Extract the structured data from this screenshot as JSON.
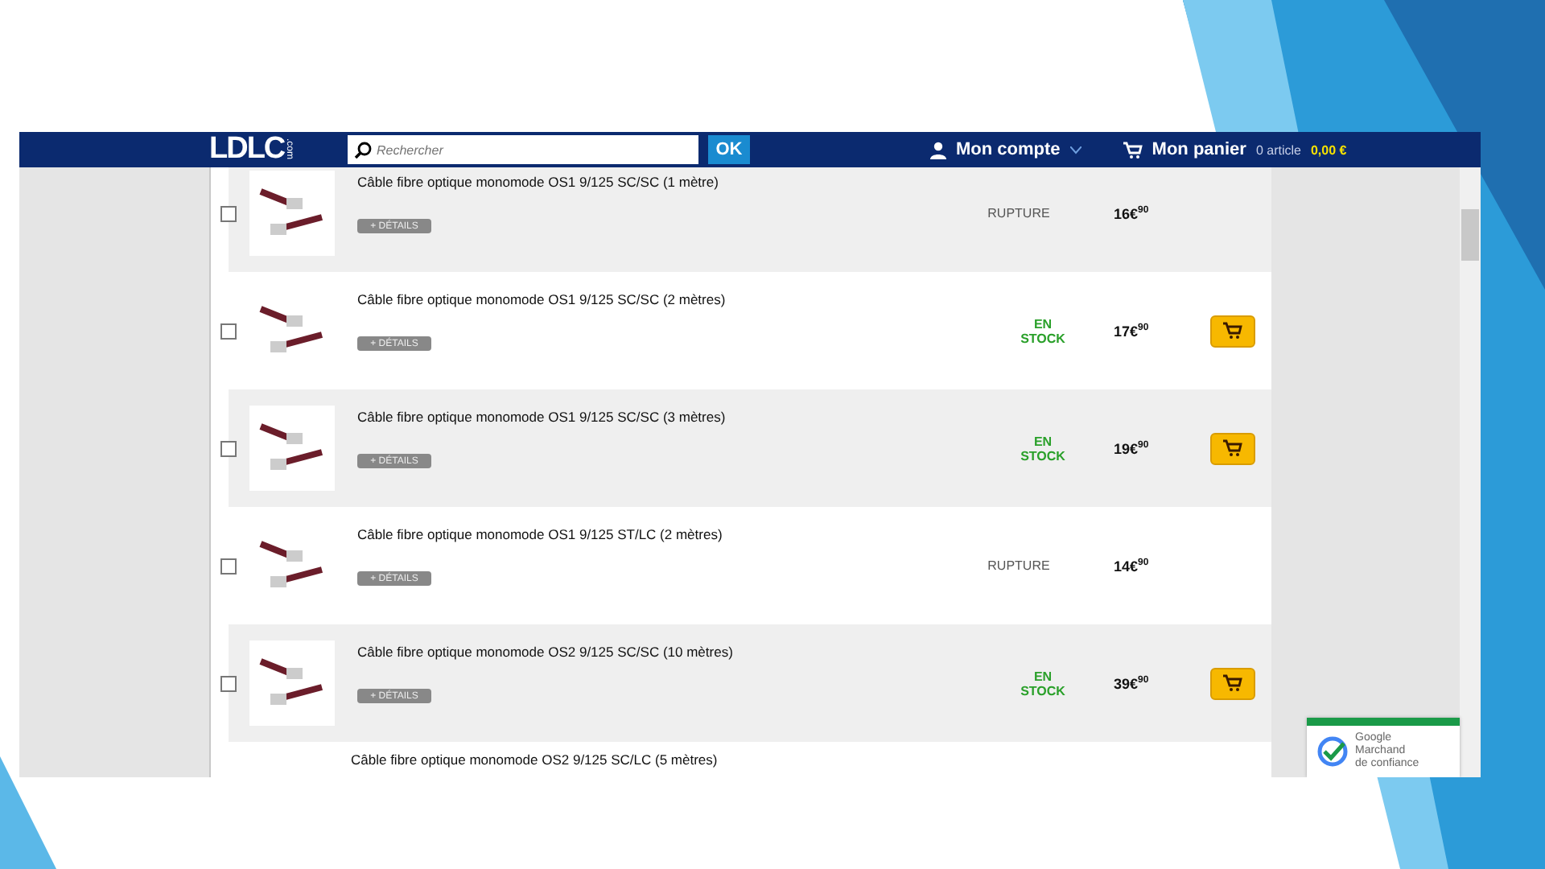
{
  "header": {
    "logo": "LDLC",
    "logo_suffix": ".com",
    "search": {
      "placeholder": "Rechercher",
      "button": "OK"
    },
    "account": "Mon compte",
    "cart": "Mon panier",
    "cart_count": "0 article",
    "cart_total": "0,00 €"
  },
  "products": [
    {
      "title": "Câble fibre optique monomode OS1 9/125 SC/SC (1 mètre)",
      "details": "+ DÉTAILS",
      "checked": false,
      "kind": "rupture",
      "stock": "RUPTURE",
      "price": "16€$^{90}$"
    },
    {
      "title": "Câble fibre optique monomode OS1 9/125 SC/SC (2 mètres)",
      "details": "+ DÉTAILS",
      "checked": false,
      "kind": "in_stock",
      "stock": "EN STOCK",
      "price": "17€$^{90}$"
    },
    {
      "title": "Câble fibre optique monomode OS1 9/125 SC/SC (3 mètres)",
      "details": "+ DÉTAILS",
      "checked": false,
      "kind": "in_stock",
      "stock": "EN STOCK",
      "price": "19€$^{90}$"
    },
    {
      "title": "Câble fibre optique monomode OS1 9/125 ST/LC (2 mètres)",
      "details": "+ DÉTAILS",
      "checked": false,
      "kind": "rupture",
      "stock": "RUPTURE",
      "price": "14€$^{90}$"
    },
    {
      "title": "Câble fibre optique monomode OS2 9/125 SC/SC (10 mètres)",
      "details": "+ DÉTAILS",
      "checked": false,
      "kind": "in_stock",
      "stock": "EN STOCK",
      "price": "39€$^{90}$"
    },
    {
      "title": "Câble fibre optique monomode OS2 9/125 SC/LC (5 mètres)",
      "kind": "partial"
    }
  ],
  "badge": {
    "lines": [
      "Google",
      "Marchand",
      "de confiance"
    ]
  }
}
